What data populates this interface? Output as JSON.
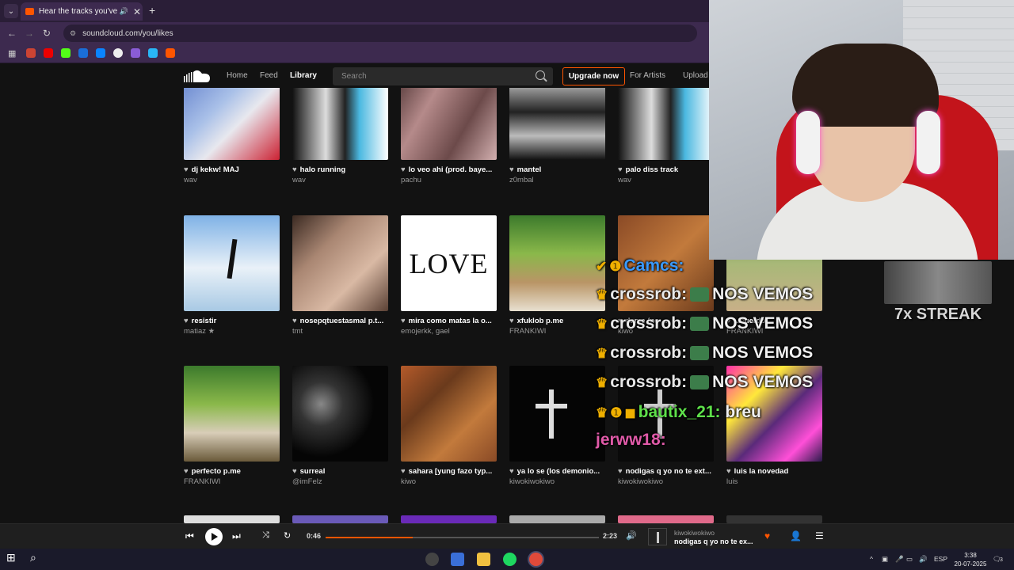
{
  "browser": {
    "tab_title": "Hear the tracks you've liked",
    "url": "soundcloud.com/you/likes"
  },
  "nav": {
    "home": "Home",
    "feed": "Feed",
    "library": "Library",
    "search_placeholder": "Search",
    "upgrade": "Upgrade now",
    "for_artists": "For Artists",
    "upload": "Upload"
  },
  "tracks": [
    {
      "title": "dj kekw! MAJ",
      "artist": "wav"
    },
    {
      "title": "halo running",
      "artist": "wav"
    },
    {
      "title": "lo veo ahi (prod. baye...",
      "artist": "pachu"
    },
    {
      "title": "mantel",
      "artist": "z0mbal"
    },
    {
      "title": "palo diss track",
      "artist": "wav"
    },
    {
      "title": "resistir",
      "artist": "matiaz ★"
    },
    {
      "title": "nosepqtuestasmal p.t...",
      "artist": "tmt"
    },
    {
      "title": "mira como matas la o...",
      "artist": "emojerkk, gael"
    },
    {
      "title": "xfuklob p.me",
      "artist": "FRANKIWI"
    },
    {
      "title": "dame (no ...",
      "artist": "kiwo"
    },
    {
      "title": "...cuerdo ...",
      "artist": "FRANKIWI"
    },
    {
      "title": "perfecto p.me",
      "artist": "FRANKIWI"
    },
    {
      "title": "surreal",
      "artist": "@imFelz"
    },
    {
      "title": "sahara [yung fazo typ...",
      "artist": "kiwo"
    },
    {
      "title": "ya lo se (los demonio...",
      "artist": "kiwokiwokiwo"
    },
    {
      "title": "nodigas q yo no te ext...",
      "artist": "kiwokiwokiwo"
    },
    {
      "title": "luis la novedad",
      "artist": "luis"
    }
  ],
  "album_art_text": {
    "love": "LOVE"
  },
  "chat": [
    {
      "user": "Camcs:",
      "msg": ""
    },
    {
      "user": "crossrob:",
      "msg": "NOS VEMOS"
    },
    {
      "user": "crossrob:",
      "msg": "NOS VEMOS"
    },
    {
      "user": "crossrob:",
      "msg": "NOS VEMOS"
    },
    {
      "user": "crossrob:",
      "msg": "NOS VEMOS"
    },
    {
      "user": "bautix_21:",
      "msg": "breu"
    },
    {
      "user": "jerww18:",
      "msg": ""
    }
  ],
  "streak": "7x STREAK",
  "player": {
    "elapsed": "0:46",
    "duration": "2:23",
    "progress": 0.32,
    "artist": "kiwokiwokiwo",
    "title": "nodigas q yo no te ex..."
  },
  "taskbar": {
    "lang": "ESP",
    "time": "3:38",
    "date": "20-07-2025",
    "notif_count": "3"
  },
  "colors": {
    "accent": "#ff5500"
  }
}
